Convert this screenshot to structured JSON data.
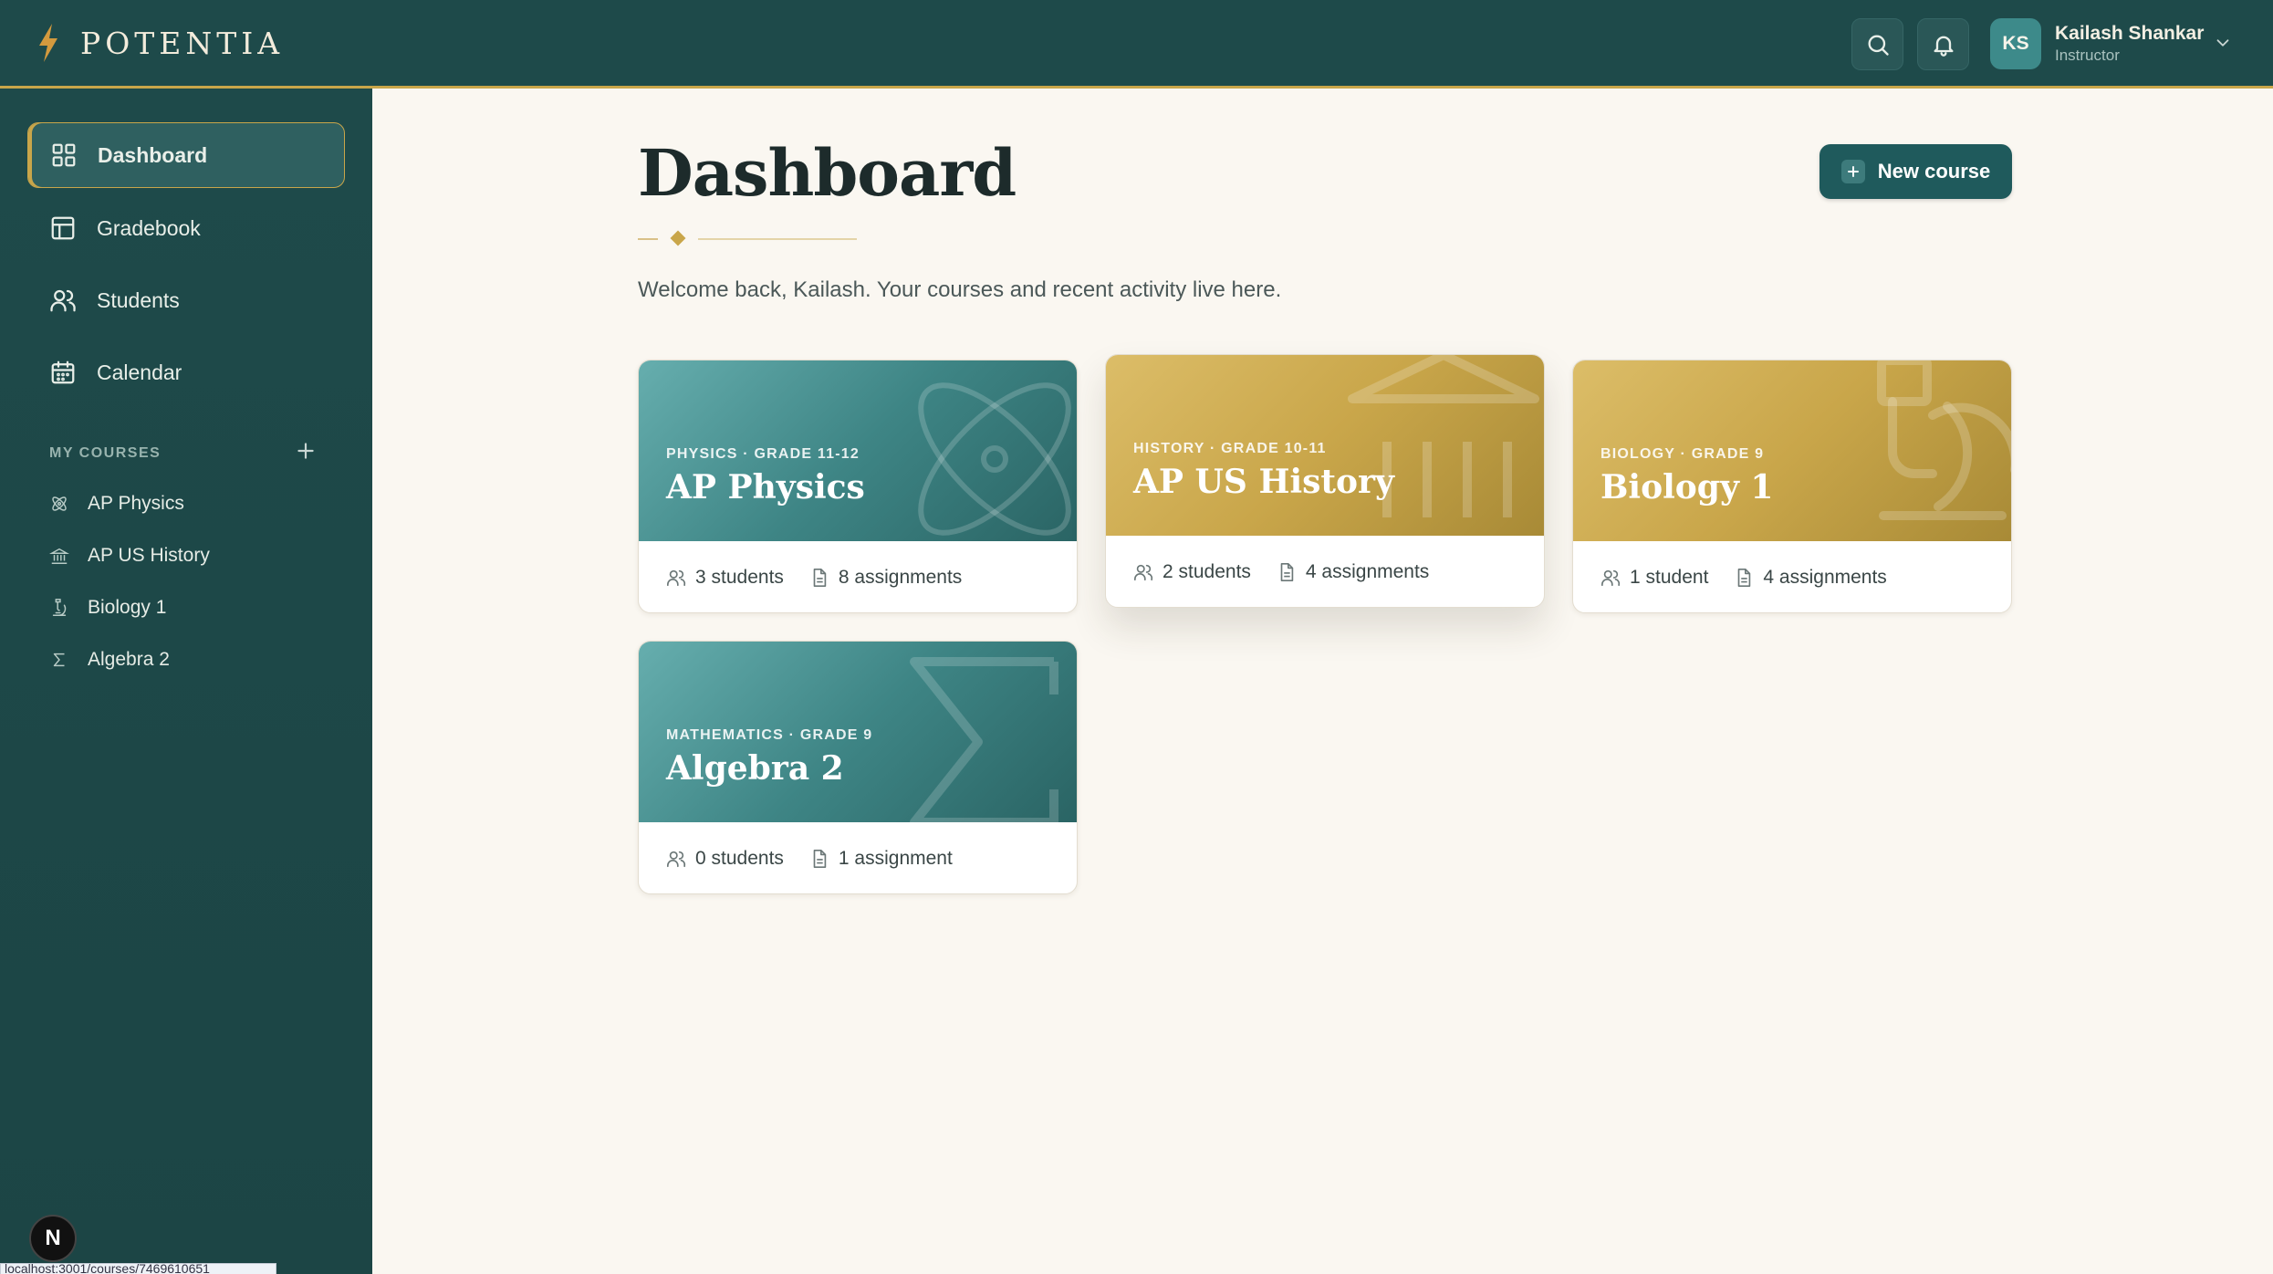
{
  "app": {
    "name": "POTENTIA"
  },
  "user": {
    "initials": "KS",
    "name": "Kailash Shankar",
    "role": "Instructor"
  },
  "nav": [
    {
      "label": "Dashboard",
      "icon": "grid-icon",
      "active": true
    },
    {
      "label": "Gradebook",
      "icon": "table-icon",
      "active": false
    },
    {
      "label": "Students",
      "icon": "users-icon",
      "active": false
    },
    {
      "label": "Calendar",
      "icon": "calendar-icon",
      "active": false
    }
  ],
  "my_courses": {
    "label": "MY COURSES",
    "items": [
      {
        "label": "AP Physics",
        "icon": "atom-icon"
      },
      {
        "label": "AP US History",
        "icon": "building-icon"
      },
      {
        "label": "Biology 1",
        "icon": "microscope-icon"
      },
      {
        "label": "Algebra 2",
        "icon": "sigma-icon"
      }
    ]
  },
  "main": {
    "title": "Dashboard",
    "welcome": "Welcome back, Kailash. Your courses and recent activity live here.",
    "new_course_label": "New course"
  },
  "courses": [
    {
      "kicker": "PHYSICS · GRADE 11-12",
      "title": "AP Physics",
      "students": "3 students",
      "assignments": "8 assignments",
      "theme": "teal"
    },
    {
      "kicker": "HISTORY · GRADE 10-11",
      "title": "AP US History",
      "students": "2 students",
      "assignments": "4 assignments",
      "theme": "gold"
    },
    {
      "kicker": "BIOLOGY · GRADE 9",
      "title": "Biology 1",
      "students": "1 student",
      "assignments": "4 assignments",
      "theme": "gold"
    },
    {
      "kicker": "MATHEMATICS · GRADE 9",
      "title": "Algebra 2",
      "students": "0 students",
      "assignments": "1 assignment",
      "theme": "teal"
    }
  ],
  "dev": {
    "badge": "N",
    "status_url": "localhost:3001/courses/7469610651"
  },
  "colors": {
    "sidebar": "#1e4a4a",
    "accent_gold": "#c9a64a",
    "teal": "#3e8585",
    "background": "#faf7f1"
  }
}
